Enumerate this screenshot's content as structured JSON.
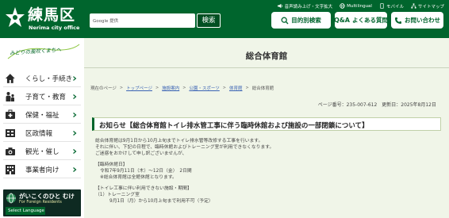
{
  "header": {
    "logo_name": "練馬区",
    "logo_sub": "Nerima city office",
    "utility_links": [
      {
        "icon": "speaker-icon",
        "label": "音声読み上げ・文字拡大"
      },
      {
        "icon": "globe-icon",
        "label": "Multilingual"
      },
      {
        "icon": "mobile-icon",
        "label": "モバイル"
      },
      {
        "icon": "sitemap-icon",
        "label": "サイトマップ"
      }
    ],
    "search": {
      "brand": "Google 提供",
      "placeholder": "",
      "button": "検索"
    },
    "buttons": {
      "purpose": "目的別検索",
      "faq_mark": "Q&A",
      "faq": "よくある質問",
      "contact": "お問い合わせ"
    }
  },
  "sidebar": {
    "slogan": "みどりの風吹くまちへ",
    "items": [
      {
        "label": "くらし・手続き",
        "icon": "house-icon"
      },
      {
        "label": "子育て・教育",
        "icon": "family-icon"
      },
      {
        "label": "保健・福祉",
        "icon": "health-icon"
      },
      {
        "label": "区政情報",
        "icon": "city-info-icon"
      },
      {
        "label": "観光・催し",
        "icon": "camera-icon"
      },
      {
        "label": "事業者向け",
        "icon": "business-icon"
      }
    ],
    "banner": {
      "title": "がいこくのひと むけ",
      "sub": "For Foreign Residents",
      "lang": "Select Language"
    }
  },
  "main": {
    "page_title": "総合体育館",
    "breadcrumb": {
      "current_label": "現在のページ",
      "links": [
        "トップページ",
        "施設案内",
        "公園・スポーツ",
        "体育館"
      ],
      "current": "総合体育館"
    },
    "page_meta": "ページ番号：235-007-612　更新日：2025年8月12日",
    "notice_title": "お知らせ【総合体育館トイレ排水管工事に伴う臨時休館および施設の一部閉鎖について】",
    "body_lines": [
      "総合体育館は9月1日から10月上旬までトイレ排水管等改修する工事を行います。",
      "それに伴い、下記の日程で、臨時休館およびトレーニング室が利用できなくなります。",
      "ご迷惑をおかけして申し訳ございませんが、",
      "",
      "【臨時休館日】",
      "令和7年9月11日（木）～12日（金）　2日間",
      "※総合体育館は全館休館となります。",
      "",
      "【トイレ工事に伴い利用できない施設・期間】",
      "（1）トレーニング室",
      "9月1日（月）から10月上旬まで利用不可（予定）"
    ]
  },
  "colors": {
    "brand_green": "#00652d",
    "content_bg": "#f0f5e8",
    "link_blue": "#3c64b4"
  }
}
